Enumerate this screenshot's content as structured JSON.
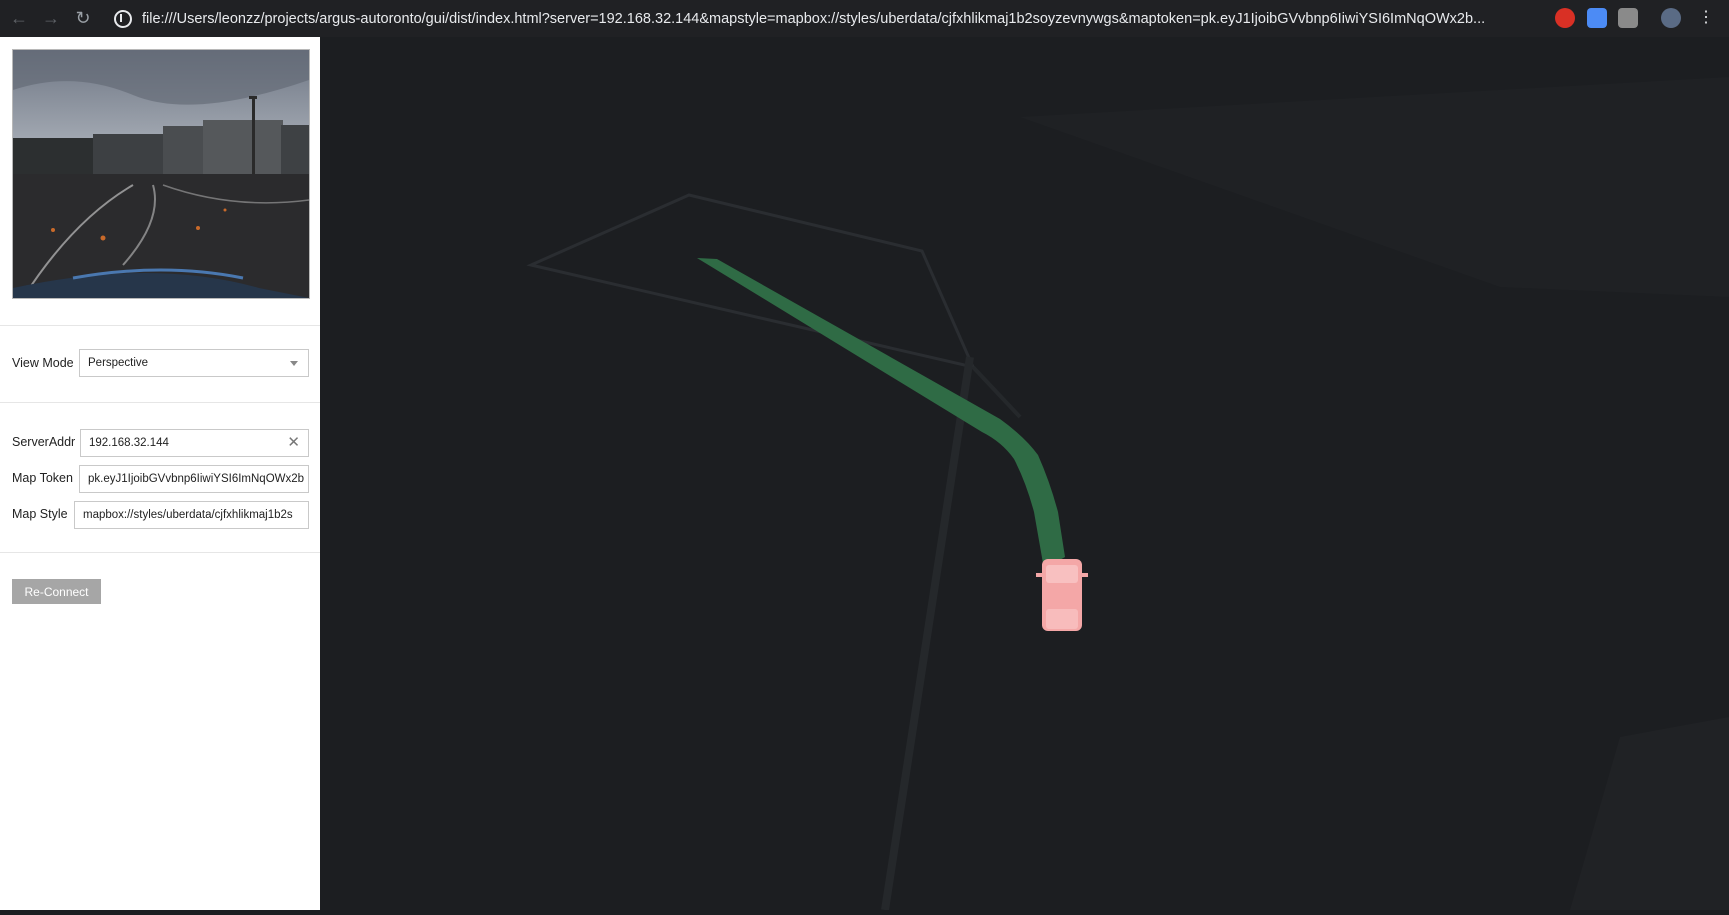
{
  "browser": {
    "url": "file:///Users/leonzz/projects/argus-autoronto/gui/dist/index.html?server=192.168.32.144&mapstyle=mapbox://styles/uberdata/cjfxhlikmaj1b2soyzevnywgs&maptoken=pk.eyJ1IjoibGVvbnp6IiwiYSI6ImNqOWx2b..."
  },
  "sidebar": {
    "view_mode": {
      "label": "View Mode",
      "selected": "Perspective"
    },
    "server_addr": {
      "label": "ServerAddr",
      "value": "192.168.32.144"
    },
    "map_token": {
      "label": "Map Token",
      "value": "pk.eyJ1IjoibGVvbnp6IiwiYSI6ImNqOWx2b"
    },
    "map_style": {
      "label": "Map Style",
      "value": "mapbox://styles/uberdata/cjfxhlikmaj1b2s"
    },
    "reconnect_label": "Re-Connect"
  },
  "colors": {
    "map_bg": "#1c1e21",
    "trajectory": "#2f6b45",
    "vehicle": "#f4a7a7",
    "button_bg": "#a6a6a6"
  },
  "icons": [
    "back-arrow-icon",
    "forward-arrow-icon",
    "reload-icon",
    "info-icon",
    "clear-icon",
    "chevron-down-icon"
  ]
}
